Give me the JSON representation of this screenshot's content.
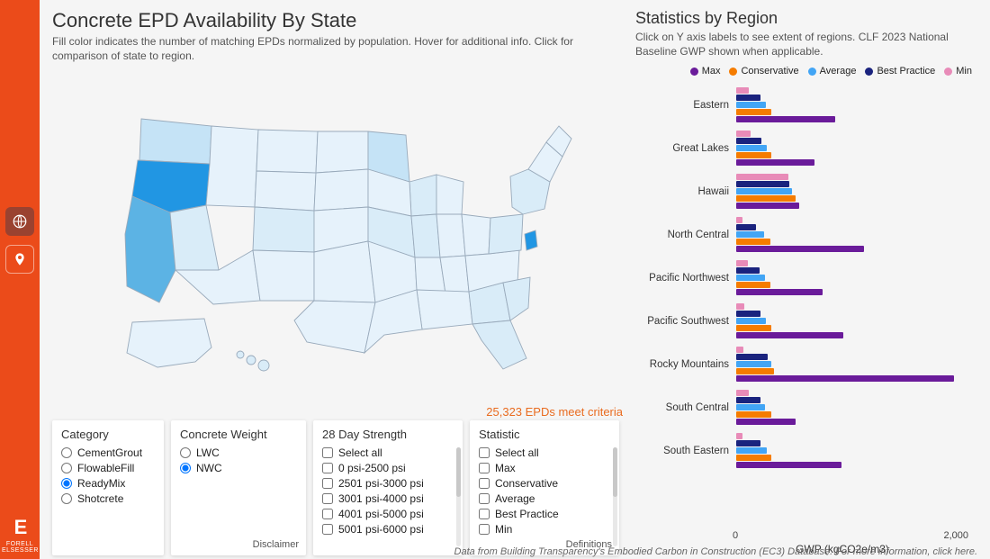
{
  "left_title": "Concrete EPD Availability By State",
  "left_sub": "Fill color indicates the number of matching EPDs normalized by population. Hover for additional info. Click for comparison of state to region.",
  "criteria_count": "25,323 EPDs meet criteria",
  "filters": {
    "category": {
      "title": "Category",
      "options": [
        "CementGrout",
        "FlowableFill",
        "ReadyMix",
        "Shotcrete"
      ],
      "selected": "ReadyMix"
    },
    "weight": {
      "title": "Concrete Weight",
      "options": [
        "LWC",
        "NWC"
      ],
      "selected": "NWC",
      "disclaimer": "Disclaimer"
    },
    "strength": {
      "title": "28 Day Strength",
      "options": [
        "Select all",
        "0 psi-2500 psi",
        "2501 psi-3000 psi",
        "3001 psi-4000 psi",
        "4001 psi-5000 psi",
        "5001 psi-6000 psi"
      ]
    },
    "statistic": {
      "title": "Statistic",
      "options": [
        "Select all",
        "Max",
        "Conservative",
        "Average",
        "Best Practice",
        "Min"
      ],
      "definitions": "Definitions"
    }
  },
  "brand_name": "FORELL ELSESSER",
  "right_title": "Statistics by Region",
  "right_sub": "Click on Y axis labels to see extent of regions. CLF 2023 National Baseline GWP shown when applicable.",
  "legend": [
    {
      "label": "Max",
      "color": "#6a1b9a"
    },
    {
      "label": "Conservative",
      "color": "#f57c00"
    },
    {
      "label": "Average",
      "color": "#42a5f5"
    },
    {
      "label": "Best Practice",
      "color": "#1a237e"
    },
    {
      "label": "Min",
      "color": "#e88bb8"
    }
  ],
  "axis": {
    "ticks": [
      "0",
      "2,000"
    ],
    "title": "GWP (kgCO2e/m3)"
  },
  "attribution": "Data from Building Transparency's Embodied Carbon in Construction (EC3) Database. For more information, click here.",
  "chart_data": {
    "type": "bar",
    "title": "Statistics by Region",
    "xlabel": "GWP (kgCO2e/m3)",
    "ylabel": "",
    "xlim": [
      0,
      2800
    ],
    "categories": [
      "Eastern",
      "Great Lakes",
      "Hawaii",
      "North Central",
      "Pacific Northwest",
      "Pacific Southwest",
      "Rocky Mountains",
      "South Central",
      "South Eastern"
    ],
    "series": [
      {
        "name": "Min",
        "color": "#e88bb8",
        "values": [
          150,
          170,
          630,
          80,
          140,
          100,
          90,
          150,
          80
        ]
      },
      {
        "name": "Best Practice",
        "color": "#1a237e",
        "values": [
          290,
          310,
          640,
          240,
          280,
          290,
          380,
          290,
          300
        ]
      },
      {
        "name": "Average",
        "color": "#42a5f5",
        "values": [
          360,
          370,
          680,
          340,
          350,
          360,
          430,
          350,
          370
        ]
      },
      {
        "name": "Conservative",
        "color": "#f57c00",
        "values": [
          430,
          430,
          720,
          420,
          420,
          430,
          460,
          430,
          430
        ]
      },
      {
        "name": "Max",
        "color": "#6a1b9a",
        "values": [
          1200,
          950,
          770,
          1550,
          1050,
          1300,
          2650,
          720,
          1280
        ]
      }
    ]
  }
}
